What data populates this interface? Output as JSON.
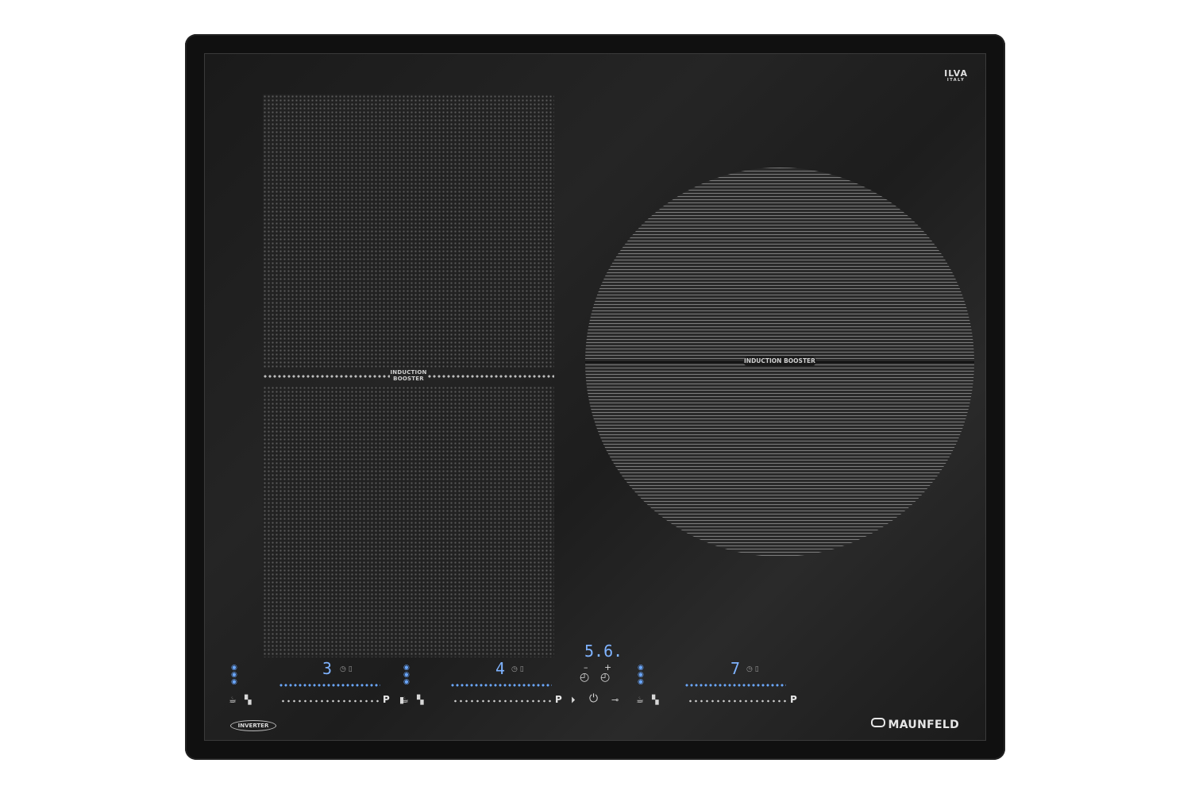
{
  "brand": {
    "top_logo": "ILVA",
    "top_logo_sub": "ITALY",
    "name": "MAUNFELD",
    "inverter_badge": "INVERTER"
  },
  "zones": {
    "left_bridge_label_1": "INDUCTION",
    "left_bridge_label_2": "BOOSTER",
    "circle_label": "INDUCTION BOOSTER"
  },
  "controls": {
    "zone1": {
      "level": "3",
      "p_label": "P"
    },
    "zone2": {
      "level": "4",
      "p_label": "P"
    },
    "zone3": {
      "level": "7",
      "p_label": "P"
    },
    "timer": {
      "value": "5.6.",
      "minus": "–",
      "plus": "+"
    }
  },
  "colors": {
    "accent": "#6aa7ff"
  }
}
